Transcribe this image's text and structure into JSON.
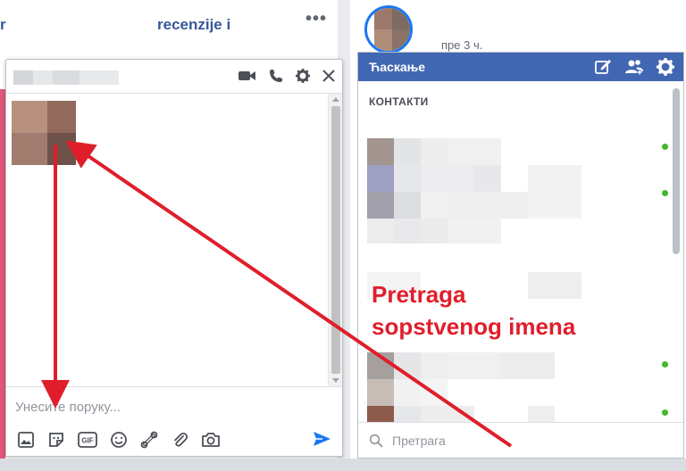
{
  "feed": {
    "post_title": "recenzije i",
    "post_title_cut": "r",
    "more_label": "•••",
    "post_time": "пре 3 ч."
  },
  "chat_window": {
    "input_placeholder": "Унесите поруку...",
    "header_icons": [
      "video-camera-icon",
      "phone-icon",
      "gear-icon",
      "close-icon"
    ],
    "toolbar_icons": [
      "photo-icon",
      "sticker-icon",
      "gif-icon",
      "emoji-icon",
      "games-icon",
      "attachment-icon",
      "camera-icon",
      "send-icon"
    ]
  },
  "contacts_panel": {
    "title": "Ћаскање",
    "section_label": "КОНТАКТИ",
    "search_placeholder": "Претрага",
    "header_icons": [
      "new-message-icon",
      "create-group-icon",
      "gear-icon"
    ]
  },
  "annotation": {
    "line1": "Pretraga",
    "line2": "sopstvenog imena"
  },
  "colors": {
    "facebook_blue": "#4267b2",
    "annotation_red": "#e01e2b",
    "online_green": "#42b72a"
  }
}
